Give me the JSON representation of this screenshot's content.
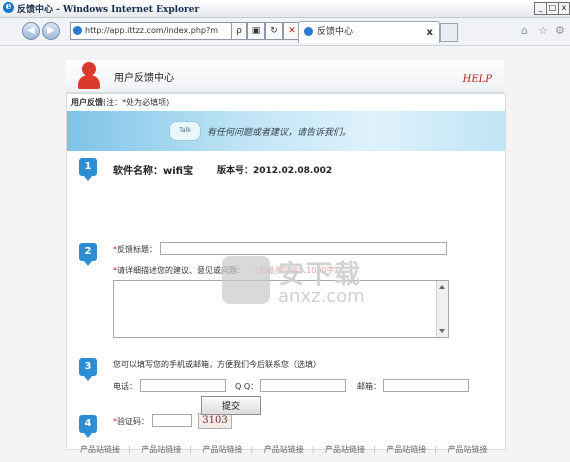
{
  "window": {
    "title": "反馈中心 - Windows Internet Explorer",
    "controls": [
      "_",
      "□",
      "x"
    ]
  },
  "browser": {
    "address": "http://app.ittzz.com/index.php?m",
    "search_icon_label": "ρ",
    "tab_title": "反馈中心",
    "tab_close": "x"
  },
  "header": {
    "title": "用户反馈中心",
    "help": "HELP"
  },
  "form": {
    "note_bold": "用户反馈",
    "note_rest": "(注：*处为必填项)",
    "slogan": "有任何问题或者建议，请告诉我们。",
    "chat_text": "Talk",
    "steps": [
      "1",
      "2",
      "3",
      "4"
    ],
    "software_name": "软件名称：wifi宝",
    "version": "版本号：2012.02.08.002",
    "title_label": "反馈标题：",
    "detail_label": "请详细描述您的建议、意见或问题：",
    "detail_hint": "(您最多可输入1000字)",
    "contact_note": "您可以填写您的手机或邮箱，方便我们今后联系您（选填）",
    "phone_label": "电话：",
    "qq_label": "Q Q：",
    "email_label": "邮箱：",
    "captcha_label": "验证码：",
    "captcha_code": "3103",
    "required_mark": "*",
    "submit_label": "提交"
  },
  "footer": {
    "links": [
      "产品站链接",
      "产品站链接",
      "产品站链接",
      "产品站链接",
      "产品站链接",
      "产品站链接",
      "产品站链接"
    ]
  },
  "watermark": {
    "cn": "安下载",
    "en": "anxz.com"
  }
}
